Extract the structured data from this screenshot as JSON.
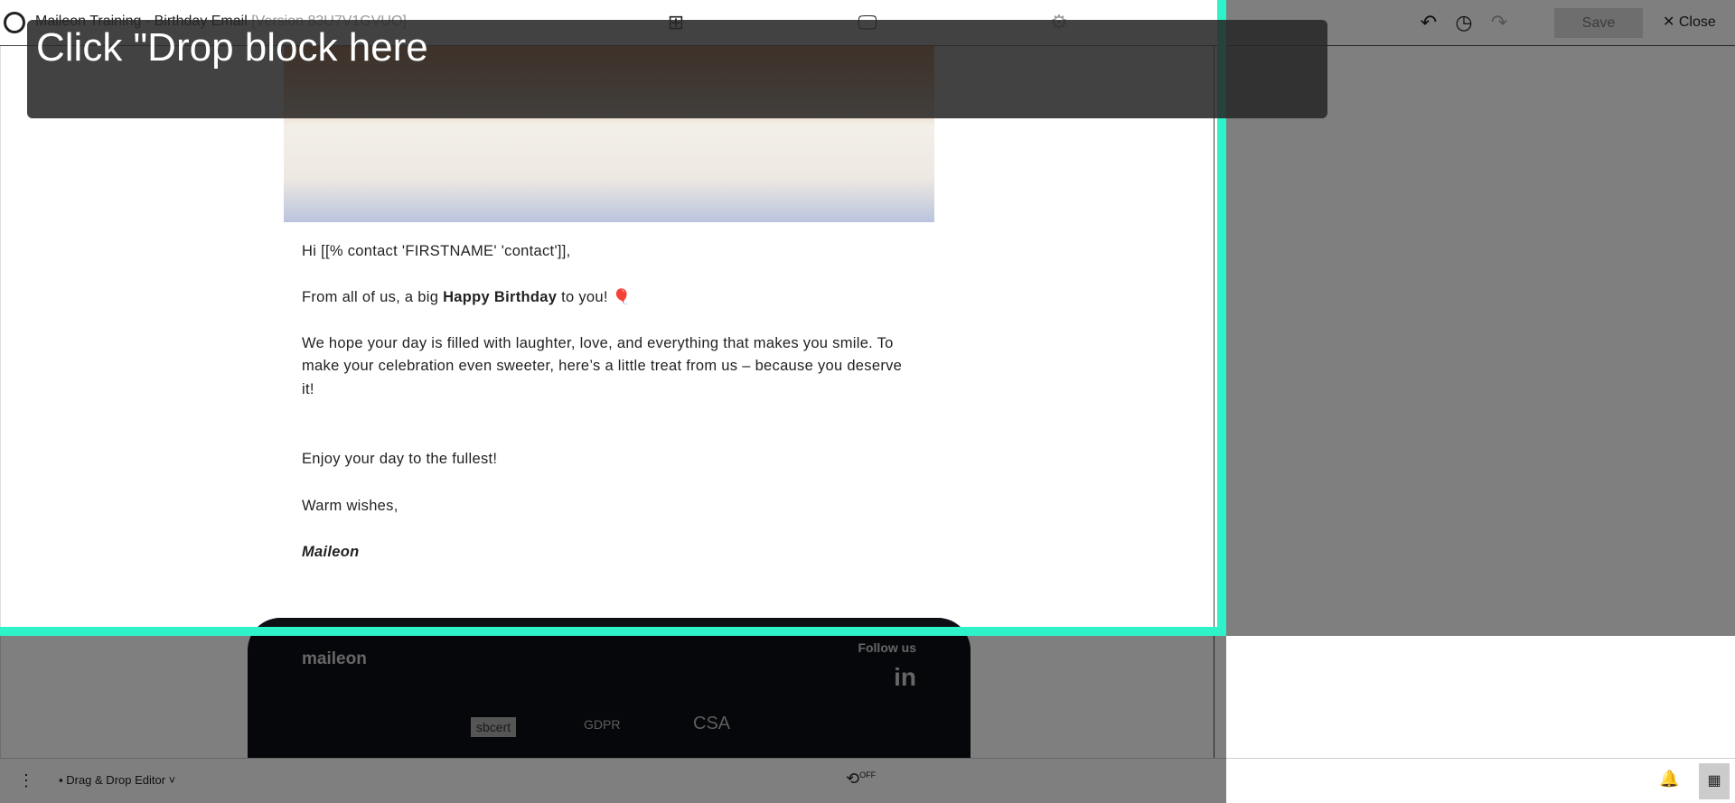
{
  "header": {
    "title": "Maileon Training - Birthday Email",
    "version": "[Version 83U7V1GVUO]",
    "save_label": "Save",
    "close_label": "Close"
  },
  "email": {
    "greeting": "Hi [[% contact 'FIRSTNAME' 'contact']],",
    "line1_pre": "From all of us, a big ",
    "line1_bold": "Happy Birthday",
    "line1_post": " to you! 🎈",
    "para1": "We hope your day is filled with laughter, love, and everything that makes you smile. To",
    "para2": "make your celebration even sweeter, here’s a little treat from us – because you deserve",
    "para3": "it!",
    "enjoy": "Enjoy your day to the fullest!",
    "wishes": "Warm wishes,",
    "signature": "Maileon"
  },
  "footer": {
    "logo": "maileon",
    "follow": "Follow us",
    "linkedin": "in",
    "badges": [
      "sbcert",
      "GDPR",
      "CSA"
    ]
  },
  "bottombar": {
    "editor_label": "Drag & Drop Editor",
    "toggle_label": "OFF"
  },
  "tooltip": {
    "text": "Click \"Drop block here"
  }
}
